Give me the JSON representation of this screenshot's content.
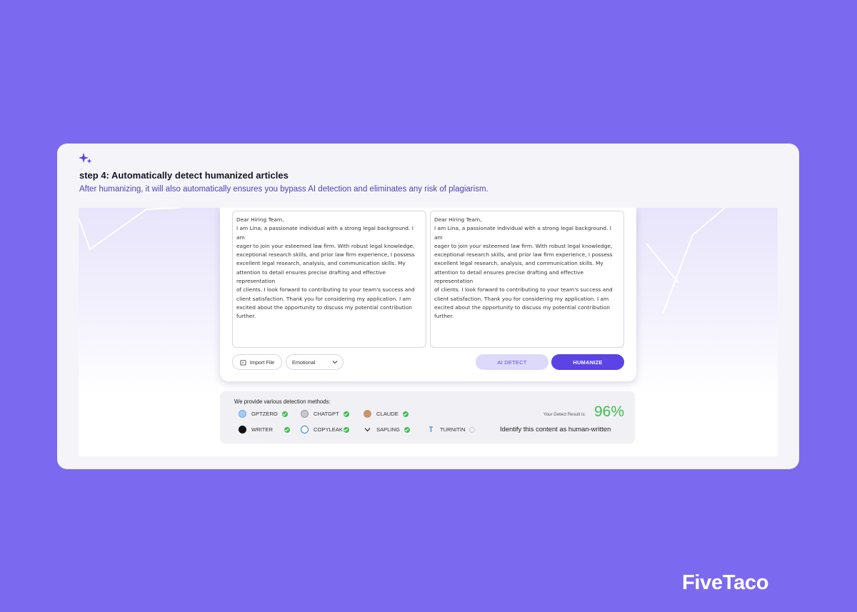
{
  "step": {
    "icon": "sparkle-icon",
    "title": "step 4: Automatically detect humanized articles",
    "description": "After humanizing, it will also automatically ensures you bypass AI detection and eliminates any risk of plagiarism."
  },
  "editor": {
    "input_lines": [
      "Dear Hiring Team,",
      "I am Lina, a passionate individual with a strong legal background. I am",
      "eager to join your esteemed law firm. With robust legal knowledge,",
      "exceptional research skills, and prior law firm experience, I possess",
      "excellent legal research, analysis, and communication skills. My",
      "attention to detail ensures precise drafting and effective representation",
      "of clients. I look forward to contributing to your team's success and",
      "client satisfaction. Thank you for considering my application. I am",
      "excited about the opportunity to discuss my potential contribution",
      "further."
    ],
    "output_lines": [
      "Dear Hiring Team,",
      "I am Lina, a passionate individual with a strong legal background. I am",
      "eager to join your esteemed law firm. With robust legal knowledge,",
      "exceptional research skills, and prior law firm experience, I possess",
      "excellent legal research, analysis, and communication skills. My",
      "attention to detail ensures precise drafting and effective representation",
      "of clients. I look forward to contributing to your team's success and",
      "client satisfaction. Thank you for considering my application. I am",
      "excited about the opportunity to discuss my potential contribution",
      "further."
    ],
    "import_label": "Import File",
    "tone_selected": "Emotional",
    "detect_label": "AI DETECT",
    "humanize_label": "HUMANIZE"
  },
  "detection": {
    "title": "We provide various detection methods:",
    "methods": [
      {
        "name": "GPTZERO",
        "status": "passed",
        "icon": "gptzero-icon",
        "color": "#6fa8f0"
      },
      {
        "name": "CHATGPT",
        "status": "passed",
        "icon": "chatgpt-icon",
        "color": "#a9a9b3"
      },
      {
        "name": "CLAUDE",
        "status": "passed",
        "icon": "claude-icon",
        "color": "#c9946a"
      },
      {
        "name": "WRITER",
        "status": "passed",
        "icon": "writer-icon",
        "color": "#111111"
      },
      {
        "name": "COPYLEAK",
        "status": "passed",
        "icon": "copyleak-icon",
        "color": "#2b7de9"
      },
      {
        "name": "SAPLING",
        "status": "passed",
        "icon": "sapling-icon",
        "color": "#333333"
      },
      {
        "name": "TURNITIN",
        "status": "pending",
        "icon": "turnitin-icon",
        "color": "#3a8de8"
      }
    ],
    "result_label": "Your Detect Result is:",
    "result_value": "96%",
    "result_note": "Identify this content as human-written",
    "success_color": "#3cbf4e"
  },
  "brand": "FiveTaco",
  "colors": {
    "background": "#7b6af0",
    "accent": "#5b43e6",
    "accent_light": "#ddd9fb"
  }
}
